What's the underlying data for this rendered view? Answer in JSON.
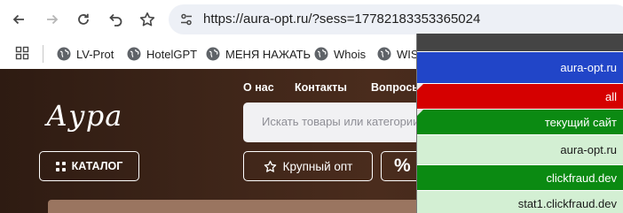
{
  "browser": {
    "url": "https://aura-opt.ru/?sess=17782183353365024",
    "buttons": {
      "back": "back-arrow-icon",
      "forward": "forward-arrow-icon",
      "reload": "reload-icon",
      "undo": "undo-icon",
      "bookmark": "star-icon",
      "site_info": "tune-icon"
    }
  },
  "bookmarks": {
    "items": [
      {
        "label": "LV-Prot",
        "icon": "globe-icon"
      },
      {
        "label": "HotelGPT",
        "icon": "globe-icon"
      },
      {
        "label": "МЕНЯ НАЖАТЬ",
        "icon": "globe-icon"
      },
      {
        "label": "Whois",
        "icon": "globe-icon"
      },
      {
        "label": "WIS",
        "icon": "globe-icon"
      }
    ]
  },
  "site": {
    "logo": "Аура",
    "nav": [
      "О нас",
      "Контакты",
      "Вопросы"
    ],
    "catalog_label": "КАТАЛОГ",
    "search_placeholder": "Искать товары или категории",
    "bulk_label": "Крупный опт",
    "percent_label": "%"
  },
  "overlay": {
    "rows": [
      {
        "label": "aura-opt.ru",
        "bg": "#2145c8",
        "style": "dark"
      },
      {
        "label": "all",
        "bg": "#d50000",
        "style": "dark"
      },
      {
        "label": "текущий сайт",
        "bg": "#0b8a12",
        "style": "dark"
      },
      {
        "label": "aura-opt.ru",
        "bg": "#d3efd3",
        "style": "light"
      },
      {
        "label": "clickfraud.dev",
        "bg": "#0b8a12",
        "style": "dark"
      },
      {
        "label": "stat1.clickfraud.dev",
        "bg": "#d3efd3",
        "style": "light"
      }
    ]
  },
  "colors": {
    "accent_blue": "#2145c8",
    "accent_red": "#d50000",
    "accent_green": "#0b8a12",
    "light_green": "#d3efd3",
    "site_brown": "#3c2418"
  }
}
